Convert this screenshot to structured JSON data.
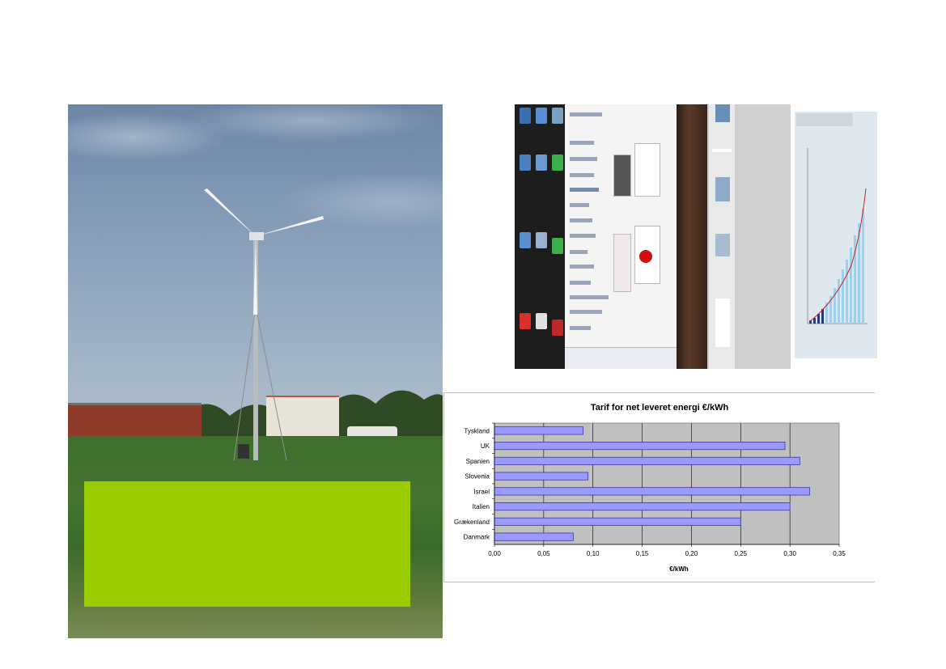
{
  "slide": {
    "photo_alt": "wind-turbine-photo",
    "green_box_color": "#99cc00"
  },
  "colors": {
    "bar_fill": "#9999ff",
    "bar_stroke": "#2b2b8c",
    "plot_bg": "#c0c0c0",
    "grid": "#000000"
  },
  "chart_data": {
    "type": "bar",
    "orientation": "horizontal",
    "title": "Tarif for net leveret energi €/kWh",
    "xlabel": "€/kWh",
    "ylabel": "",
    "categories": [
      "Tyskland",
      "UK",
      "Spanien",
      "Slovenia",
      "Israel",
      "Italien",
      "Grækenland",
      "Danmark"
    ],
    "values": [
      0.09,
      0.295,
      0.31,
      0.095,
      0.32,
      0.3,
      0.25,
      0.08
    ],
    "xlim": [
      0,
      0.35
    ],
    "xticks": [
      "0,00",
      "0,05",
      "0,10",
      "0,15",
      "0,20",
      "0,25",
      "0,30",
      "0,35"
    ],
    "grid": "vertical",
    "legend": "none"
  }
}
